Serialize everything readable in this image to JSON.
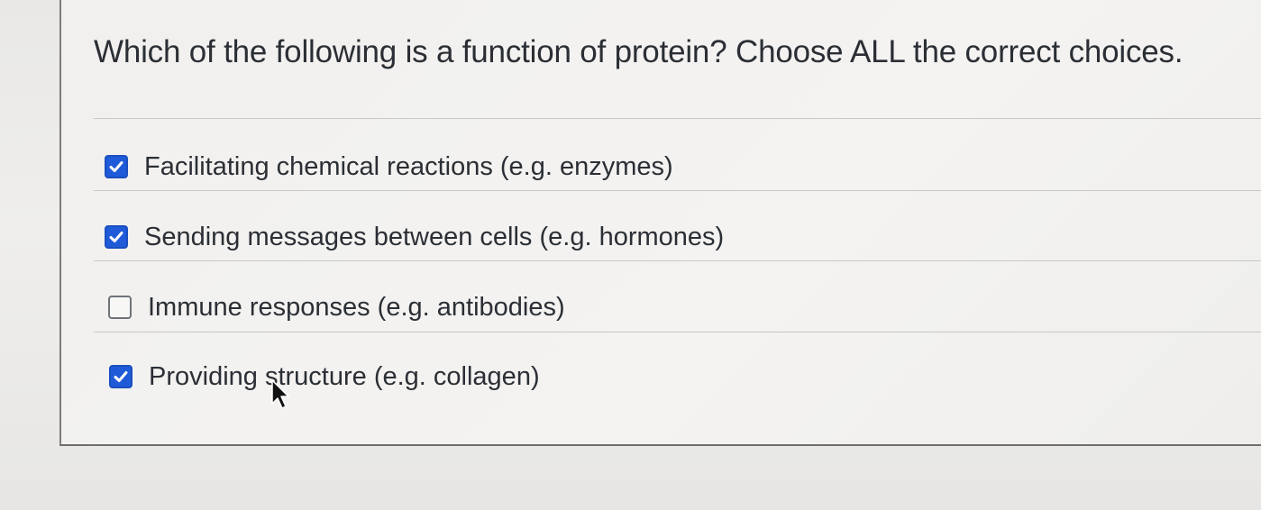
{
  "question": {
    "text": "Which of the following is a function of protein? Choose ALL the correct choices."
  },
  "answers": [
    {
      "label": "Facilitating chemical reactions (e.g. enzymes)",
      "checked": true
    },
    {
      "label": "Sending messages between cells (e.g. hormones)",
      "checked": true
    },
    {
      "label": "Immune responses (e.g. antibodies)",
      "checked": false
    },
    {
      "label": "Providing structure (e.g. collagen)",
      "checked": true
    }
  ],
  "colors": {
    "checkbox_checked": "#1f5bd8",
    "text": "#2b2f35",
    "background": "#efeeec"
  },
  "icons": {
    "checkmark": "checkmark-icon",
    "cursor": "mouse-pointer-icon"
  }
}
